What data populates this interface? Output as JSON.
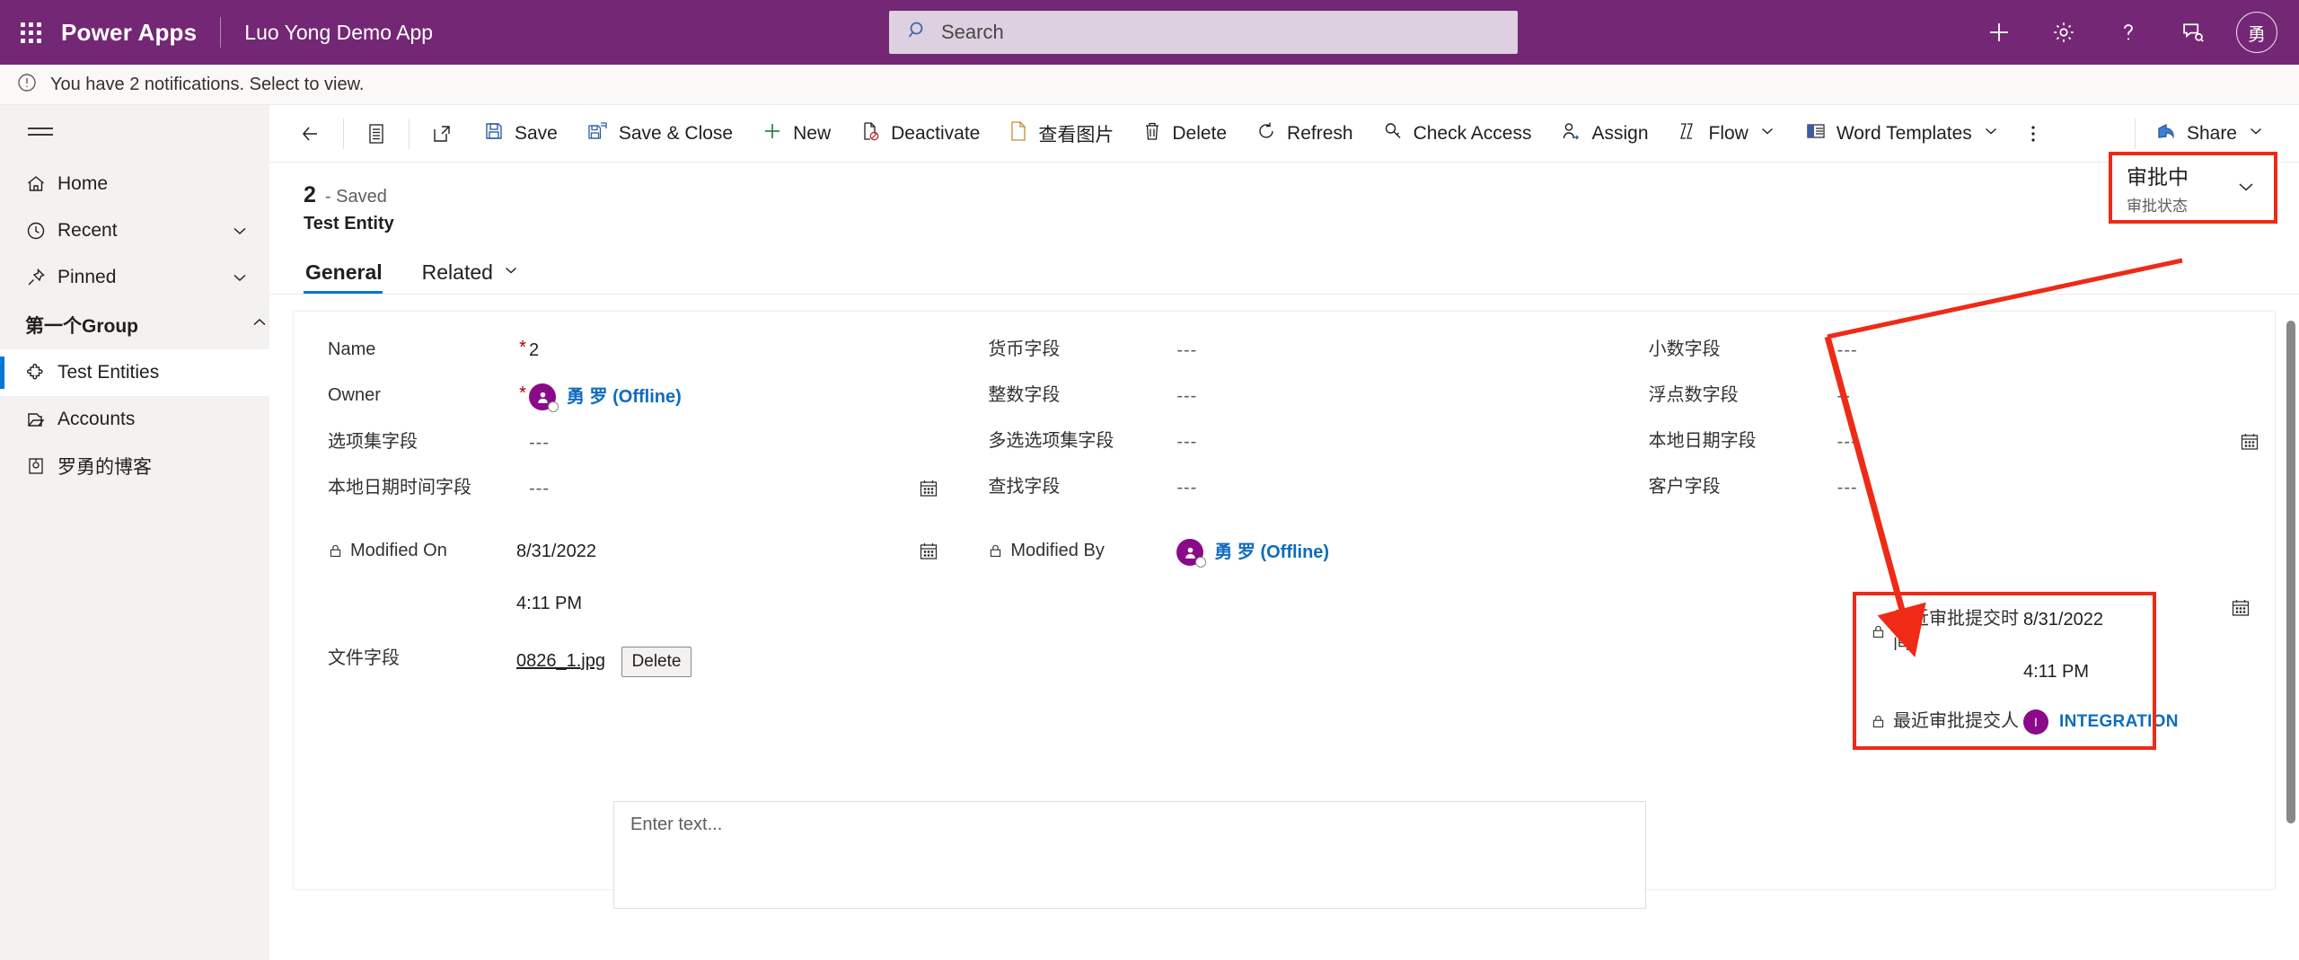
{
  "header": {
    "brand": "Power Apps",
    "app_name": "Luo Yong Demo App",
    "search_placeholder": "Search",
    "icons": {
      "waffle": "app-launcher-icon",
      "search": "search-icon",
      "new": "plus-icon",
      "settings": "gear-icon",
      "help": "question-mark-icon",
      "feedback": "feedback-icon"
    },
    "avatar_initial": "勇",
    "accent_color": "#742774"
  },
  "notification": {
    "text": "You have 2 notifications. Select to view.",
    "icon": "exclamation-circle-icon"
  },
  "sidebar": {
    "hamburger": "hamburger-icon",
    "items": [
      {
        "label": "Home",
        "icon": "home-icon",
        "expandable": false,
        "selected": false
      },
      {
        "label": "Recent",
        "icon": "clock-icon",
        "expandable": true,
        "selected": false
      },
      {
        "label": "Pinned",
        "icon": "pin-icon",
        "expandable": true,
        "selected": false
      }
    ],
    "group": {
      "label": "第一个Group",
      "expanded": true,
      "items": [
        {
          "label": "Test Entities",
          "icon": "puzzle-icon",
          "selected": true
        },
        {
          "label": "Accounts",
          "icon": "account-icon",
          "selected": false
        },
        {
          "label": "罗勇的博客",
          "icon": "blog-icon",
          "selected": false
        }
      ]
    }
  },
  "command_bar": {
    "back": "back-arrow-icon",
    "form_selector": "form-icon",
    "popout": "popout-icon",
    "buttons": [
      {
        "label": "Save",
        "icon": "save-icon"
      },
      {
        "label": "Save & Close",
        "icon": "save-close-icon"
      },
      {
        "label": "New",
        "icon": "plus-icon"
      },
      {
        "label": "Deactivate",
        "icon": "deactivate-icon"
      },
      {
        "label": "查看图片",
        "icon": "page-icon"
      },
      {
        "label": "Delete",
        "icon": "trash-icon"
      },
      {
        "label": "Refresh",
        "icon": "refresh-icon"
      },
      {
        "label": "Check Access",
        "icon": "key-icon"
      },
      {
        "label": "Assign",
        "icon": "assign-user-icon"
      },
      {
        "label": "Flow",
        "icon": "flow-icon",
        "chevron": true
      },
      {
        "label": "Word Templates",
        "icon": "word-icon",
        "chevron": true
      }
    ],
    "overflow": "more-vertical-icon",
    "share": {
      "label": "Share",
      "icon": "share-icon",
      "chevron": true
    }
  },
  "record": {
    "number": "2",
    "saved_status": "- Saved",
    "entity_name": "Test Entity",
    "approval_chip": {
      "value": "审批中",
      "label": "审批状态",
      "chevron": "chevron-down-icon",
      "highlight_color": "#ef2a16"
    }
  },
  "tabs": [
    {
      "label": "General",
      "active": true,
      "chevron": false
    },
    {
      "label": "Related",
      "active": false,
      "chevron": true
    }
  ],
  "form": {
    "col1": [
      {
        "label": "Name",
        "required": true,
        "value": "2",
        "type": "text"
      },
      {
        "label": "Owner",
        "required": true,
        "value": "勇 罗 (Offline)",
        "type": "person"
      },
      {
        "label": "选项集字段",
        "required": false,
        "value": "---",
        "type": "dash"
      },
      {
        "label": "本地日期时间字段",
        "required": false,
        "value": "---",
        "type": "dash",
        "calendar": true
      }
    ],
    "col2": [
      {
        "label": "货币字段",
        "required": false,
        "value": "---",
        "type": "dash"
      },
      {
        "label": "整数字段",
        "required": false,
        "value": "---",
        "type": "dash"
      },
      {
        "label": "多选选项集字段",
        "required": false,
        "value": "---",
        "type": "dash"
      },
      {
        "label": "查找字段",
        "required": false,
        "value": "---",
        "type": "dash"
      }
    ],
    "col3": [
      {
        "label": "小数字段",
        "required": false,
        "value": "---",
        "type": "dash"
      },
      {
        "label": "浮点数字段",
        "required": false,
        "value": "--",
        "type": "dash"
      },
      {
        "label": "本地日期字段",
        "required": false,
        "value": "---",
        "type": "dash",
        "calendar": true
      },
      {
        "label": "客户字段",
        "required": false,
        "value": "---",
        "type": "dash"
      }
    ],
    "modified_on": {
      "label": "Modified On",
      "locked": true,
      "date": "8/31/2022",
      "time": "4:11 PM",
      "calendar": true
    },
    "modified_by": {
      "label": "Modified By",
      "locked": true,
      "value": "勇 罗 (Offline)"
    },
    "file_field": {
      "label": "文件字段",
      "file_name": "0826_1.jpg",
      "delete_label": "Delete"
    },
    "approval_block": {
      "highlight_color": "#ef2a16",
      "rows": [
        {
          "label": "最近审批提交时间",
          "locked": true,
          "date": "8/31/2022",
          "time": "4:11 PM",
          "type": "datetime"
        },
        {
          "label": "最近审批提交人",
          "locked": true,
          "value": "INTEGRATION",
          "avatar_initial": "I",
          "type": "person"
        }
      ]
    },
    "text_area": {
      "placeholder": "Enter text..."
    }
  }
}
